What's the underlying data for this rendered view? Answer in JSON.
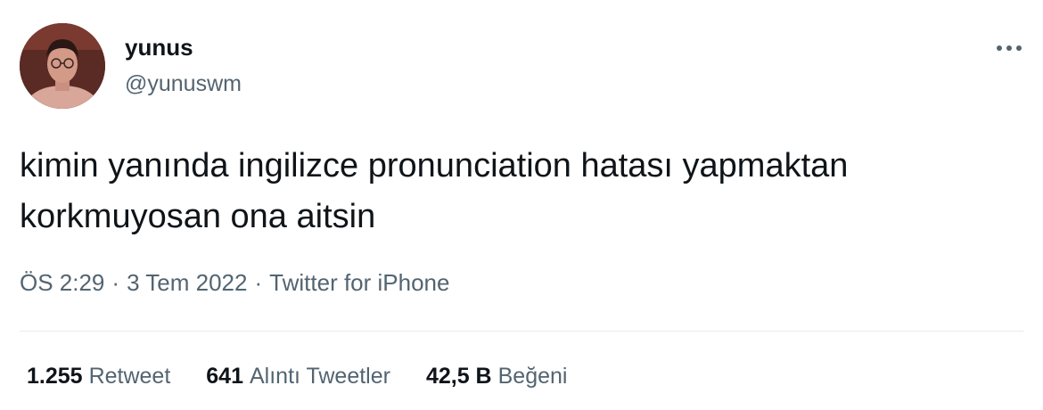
{
  "author": {
    "name": "yunus",
    "handle": "@yunuswm"
  },
  "tweet": {
    "text": "kimin yanında ingilizce pronunciation hatası yapmaktan korkmuyosan ona aitsin"
  },
  "meta": {
    "time": "ÖS 2:29",
    "date": "3 Tem 2022",
    "source": "Twitter for iPhone",
    "separator": "·"
  },
  "stats": {
    "retweets": {
      "count": "1.255",
      "label": "Retweet"
    },
    "quotes": {
      "count": "641",
      "label": "Alıntı Tweetler"
    },
    "likes": {
      "count": "42,5 B",
      "label": "Beğeni"
    }
  },
  "icons": {
    "more": "more-horizontal-icon"
  },
  "colors": {
    "text_primary": "#0f1419",
    "text_secondary": "#536471",
    "divider": "#e6ecf0"
  }
}
